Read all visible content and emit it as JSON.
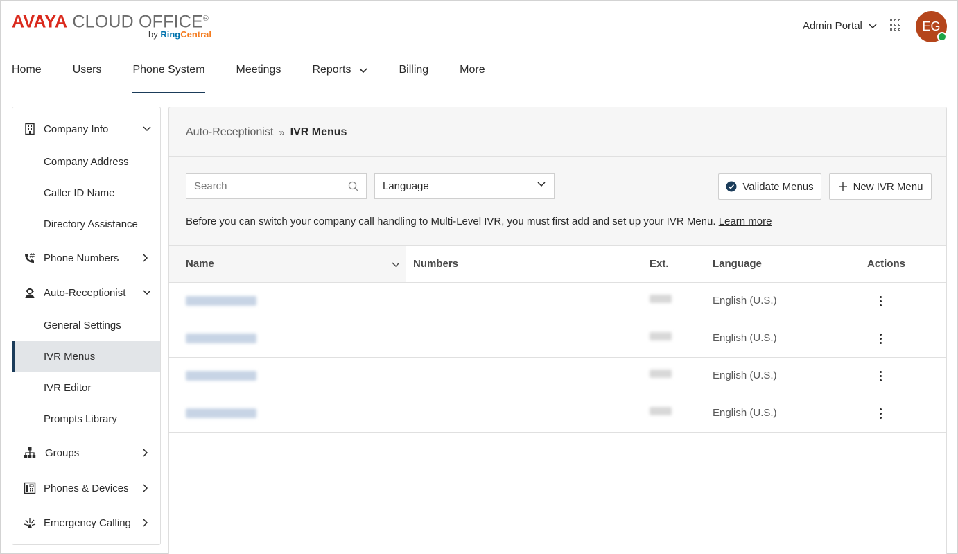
{
  "header": {
    "logo_brand": "AVAYA",
    "logo_product": " CLOUD OFFICE",
    "logo_reg": "®",
    "logo_by": "by ",
    "logo_partner_a": "Ring",
    "logo_partner_b": "Central",
    "admin_portal_label": "Admin Portal",
    "avatar_initials": "EG"
  },
  "topnav": {
    "items": [
      {
        "label": "Home"
      },
      {
        "label": "Users"
      },
      {
        "label": "Phone System"
      },
      {
        "label": "Meetings"
      },
      {
        "label": "Reports"
      },
      {
        "label": "Billing"
      },
      {
        "label": "More"
      }
    ],
    "active": "Phone System"
  },
  "sidebar": {
    "company_info": "Company Info",
    "company_address": "Company Address",
    "caller_id_name": "Caller ID Name",
    "directory_assistance": "Directory Assistance",
    "phone_numbers": "Phone Numbers",
    "auto_receptionist": "Auto-Receptionist",
    "general_settings": "General Settings",
    "ivr_menus": "IVR Menus",
    "ivr_editor": "IVR Editor",
    "prompts_library": "Prompts Library",
    "groups": "Groups",
    "phones_devices": "Phones & Devices",
    "emergency_calling": "Emergency Calling"
  },
  "breadcrumb": {
    "parent": "Auto-Receptionist",
    "separator": "»",
    "current": "IVR Menus"
  },
  "toolbar": {
    "search_placeholder": "Search",
    "language_select": "Language",
    "validate_label": "Validate Menus",
    "new_label": "New IVR Menu"
  },
  "info": {
    "text": "Before you can switch your company call handling to Multi-Level IVR, you must first add and set up your IVR Menu. ",
    "link": "Learn more"
  },
  "table": {
    "columns": {
      "name": "Name",
      "numbers": "Numbers",
      "ext": "Ext.",
      "language": "Language",
      "actions": "Actions"
    },
    "rows": [
      {
        "language": "English (U.S.)"
      },
      {
        "language": "English (U.S.)"
      },
      {
        "language": "English (U.S.)"
      },
      {
        "language": "English (U.S.)"
      }
    ]
  },
  "colors": {
    "brand_red": "#da291c",
    "nav_active": "#1b3c5a",
    "avatar_bg": "#b5451b",
    "status_green": "#1ea446"
  }
}
